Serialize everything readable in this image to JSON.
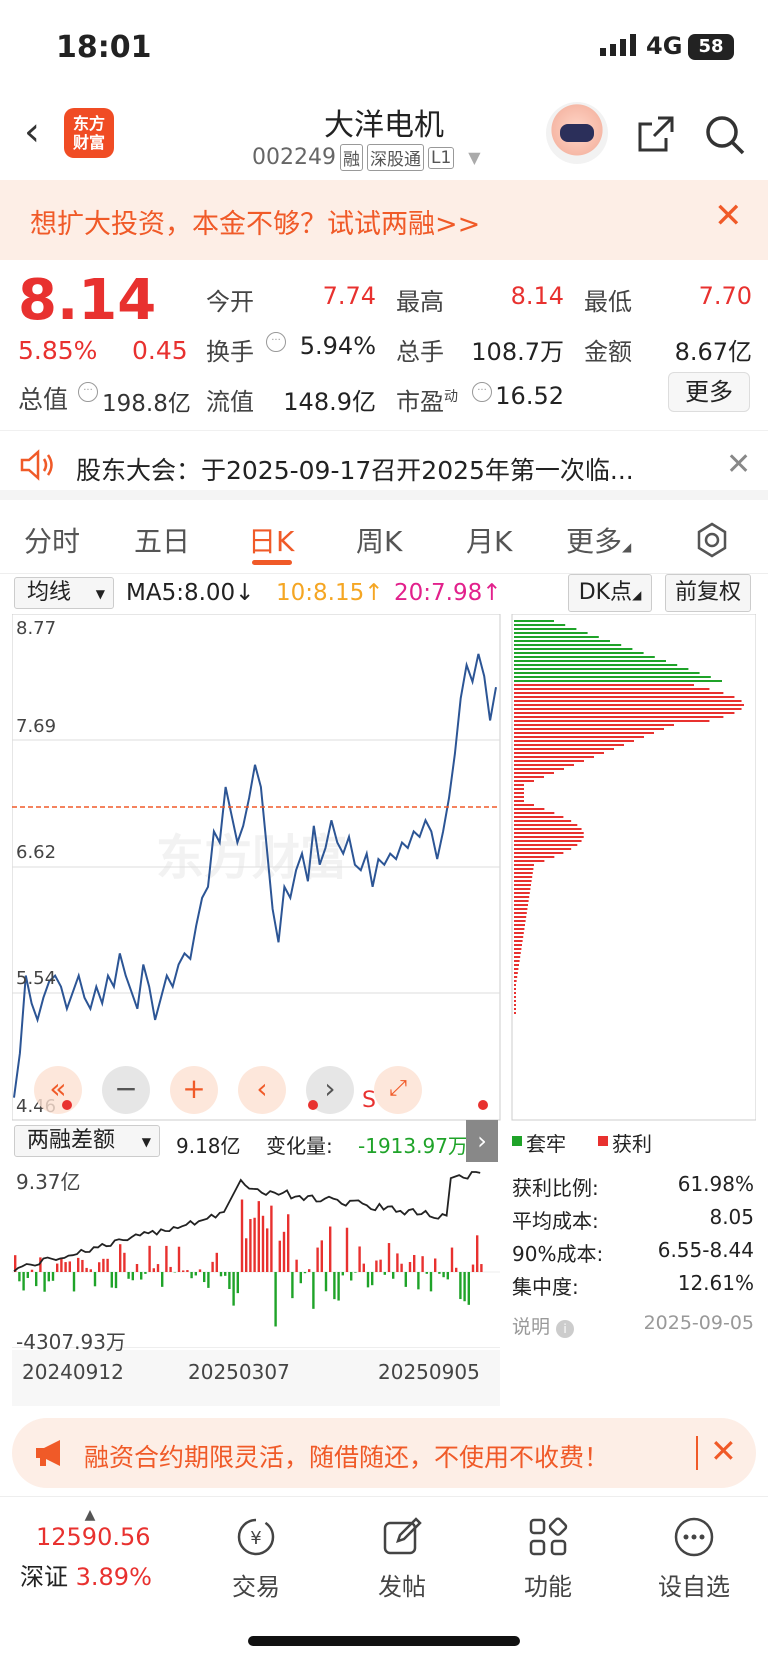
{
  "status_bar": {
    "time": "18:01",
    "network": "4G",
    "battery": "58"
  },
  "header": {
    "stock_name": "大洋电机",
    "stock_code": "002249",
    "tags": [
      "融",
      "深股通",
      "L1"
    ],
    "logo_text": "东方财富"
  },
  "promo": {
    "text": "想扩大投资，本金不够？试试两融>>"
  },
  "quote": {
    "price": "8.14",
    "change_pct": "5.85%",
    "change_amt": "0.45",
    "total_value_label": "总值",
    "total_value": "198.8亿",
    "rows": [
      [
        {
          "label": "今开",
          "value": "7.74",
          "color": "red"
        },
        {
          "label": "最高",
          "value": "8.14",
          "color": "red"
        },
        {
          "label": "最低",
          "value": "7.70",
          "color": "red"
        }
      ],
      [
        {
          "label": "换手",
          "value": "5.94%",
          "color": "black"
        },
        {
          "label": "总手",
          "value": "108.7万",
          "color": "black"
        },
        {
          "label": "金额",
          "value": "8.67亿",
          "color": "black"
        }
      ],
      [
        {
          "label": "流值",
          "value": "148.9亿",
          "color": "black"
        },
        {
          "label": "市盈",
          "sup": "动",
          "value": "16.52",
          "color": "black"
        }
      ]
    ],
    "more_label": "更多"
  },
  "notice": {
    "text": "股东大会：于2025-09-17召开2025年第一次临..."
  },
  "tabs": [
    "分时",
    "五日",
    "日K",
    "周K",
    "月K",
    "更多"
  ],
  "active_tab": 2,
  "chart_controls": {
    "ma_select": "均线",
    "ma5": "MA5:8.00↓",
    "ma10": "10:8.15↑",
    "ma20": "20:7.98↑",
    "dk_label": "DK点",
    "fq_label": "前复权"
  },
  "chart_data": [
    {
      "type": "line",
      "title": "",
      "y_ticks": [
        "8.77",
        "7.69",
        "6.62",
        "5.54",
        "4.46"
      ],
      "ylim": [
        4.46,
        8.77
      ],
      "current_price_line": 7.12,
      "series": [
        {
          "values": [
            4.5,
            4.9,
            5.6,
            5.35,
            5.2,
            5.4,
            5.55,
            5.6,
            5.5,
            5.3,
            5.45,
            5.6,
            5.4,
            5.3,
            5.5,
            5.35,
            5.6,
            5.5,
            5.8,
            5.6,
            5.45,
            5.3,
            5.7,
            5.5,
            5.2,
            5.4,
            5.6,
            5.5,
            5.7,
            5.8,
            5.75,
            6.05,
            6.3,
            6.4,
            6.9,
            6.8,
            7.3,
            7.05,
            6.8,
            6.95,
            7.2,
            7.5,
            7.3,
            6.75,
            6.2,
            5.9,
            6.4,
            6.3,
            6.55,
            6.7,
            6.45,
            6.95,
            6.6,
            6.75,
            7.0,
            6.8,
            6.7,
            6.85,
            6.6,
            6.55,
            6.7,
            6.4,
            6.65,
            6.6,
            6.7,
            6.65,
            6.8,
            6.75,
            6.9,
            6.85,
            7.0,
            6.9,
            6.65,
            6.9,
            7.2,
            7.6,
            8.1,
            8.4,
            8.25,
            8.5,
            8.3,
            7.9,
            8.2
          ]
        }
      ]
    },
    {
      "type": "bar",
      "title": "两融差额",
      "summary": "9.18亿",
      "change_label": "变化量:",
      "change_value": "-1913.97万",
      "y_top": "9.37亿",
      "y_bottom": "-4307.93万",
      "x_labels": [
        "20240912",
        "20250307",
        "20250905"
      ]
    }
  ],
  "chip_distribution": {
    "legend_trapped": "套牢",
    "legend_profit": "获利",
    "stats": [
      {
        "label": "获利比例:",
        "value": "61.98%"
      },
      {
        "label": "平均成本:",
        "value": "8.05"
      },
      {
        "label": "90%成本:",
        "value": "6.55-8.44"
      },
      {
        "label": "集中度:",
        "value": "12.61%"
      }
    ],
    "note_label": "说明",
    "date": "2025-09-05"
  },
  "banner": {
    "text": "融资合约期限灵活，随借随还，不使用不收费！"
  },
  "nav": {
    "index_value": "12590.56",
    "index_name": "深证",
    "index_pct": "3.89%",
    "items": [
      "交易",
      "发帖",
      "功能",
      "设自选"
    ]
  },
  "colors": {
    "accent": "#f05a28",
    "up": "#e8312f",
    "down": "#1fa329",
    "line": "#2c5595"
  }
}
